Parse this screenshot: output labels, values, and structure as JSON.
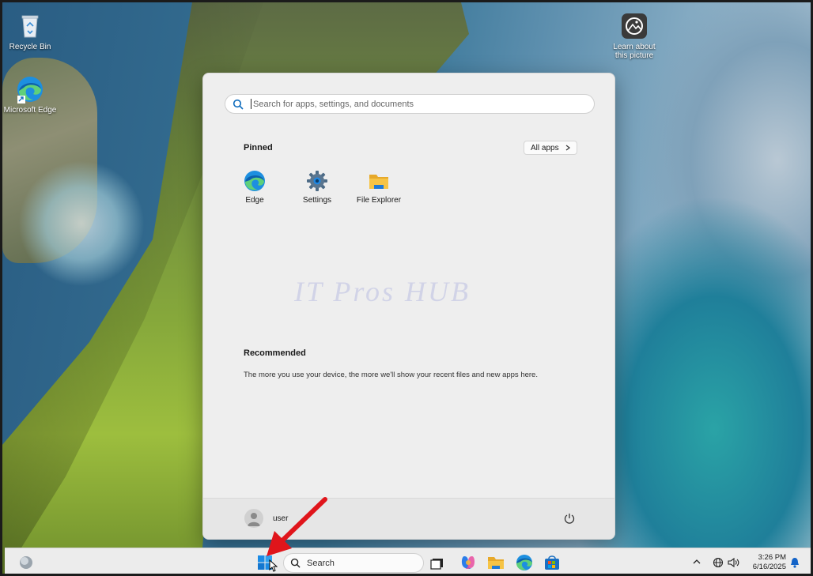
{
  "desktop": {
    "icons": [
      {
        "label": "Recycle Bin"
      },
      {
        "label": "Microsoft Edge"
      },
      {
        "label": "Learn about this picture"
      }
    ]
  },
  "start_menu": {
    "search_placeholder": "Search for apps, settings, and documents",
    "pinned_title": "Pinned",
    "all_apps_label": "All apps",
    "pinned_apps": [
      {
        "label": "Edge",
        "icon": "edge-icon"
      },
      {
        "label": "Settings",
        "icon": "gear-icon"
      },
      {
        "label": "File Explorer",
        "icon": "folder-icon"
      }
    ],
    "watermark": "IT Pros HUB",
    "recommended_title": "Recommended",
    "recommended_text": "The more you use your device, the more we'll show your recent files and new apps here.",
    "user_name": "user"
  },
  "taskbar": {
    "search_label": "Search",
    "time": "3:26 PM",
    "date": "6/16/2025"
  },
  "colors": {
    "accent": "#0078d4",
    "annotation_arrow": "#e0151b",
    "folder": "#f2c037"
  }
}
